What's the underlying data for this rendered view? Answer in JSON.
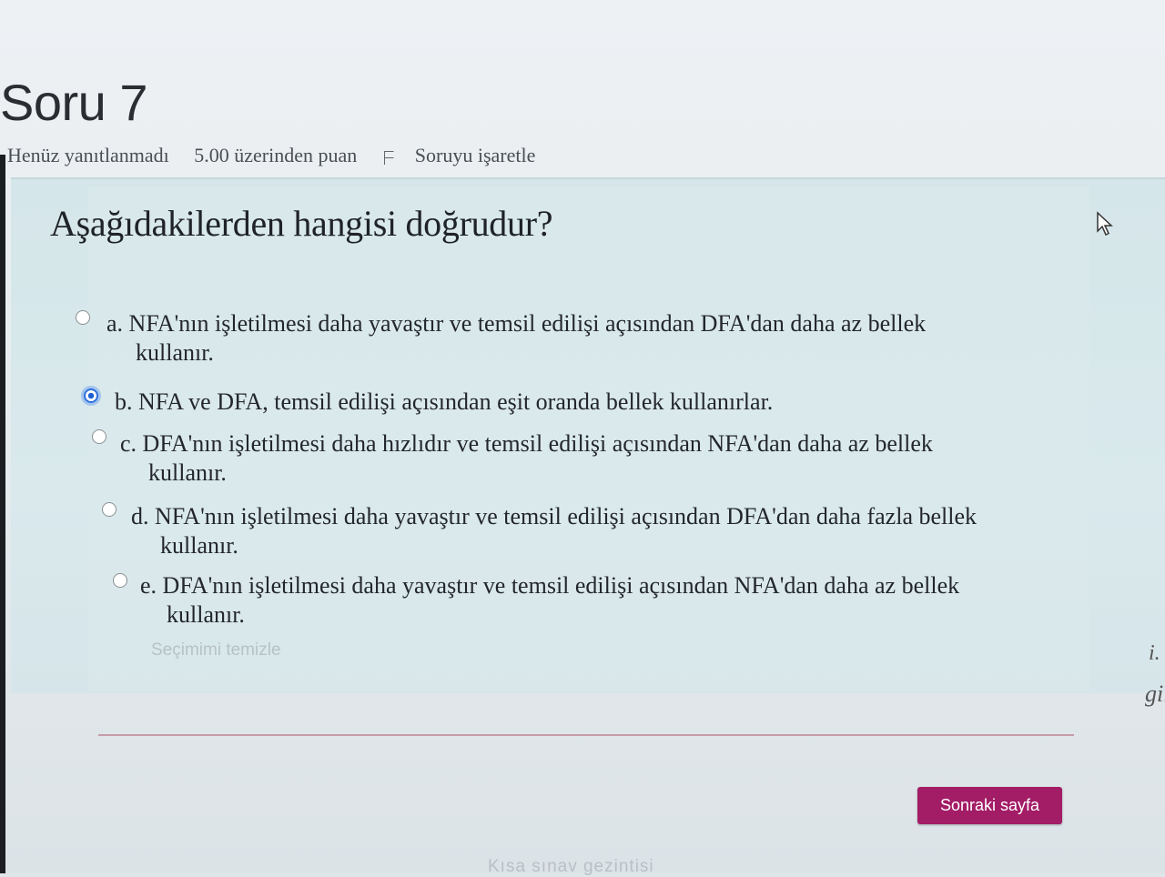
{
  "header": {
    "title": "Soru 7",
    "status": "Henüz yanıtlanmadı",
    "points": "5.00 üzerinden puan",
    "flag_label": "Soruyu işaretle"
  },
  "question": {
    "text": "Aşağıdakilerden hangisi doğrudur?",
    "options": [
      {
        "line1": "a. NFA'nın işletilmesi daha yavaştır ve temsil edilişi açısından DFA'dan daha az bellek",
        "line2": "kullanır.",
        "selected": false
      },
      {
        "line1": "b. NFA ve DFA, temsil edilişi açısından eşit oranda bellek kullanırlar.",
        "line2": "",
        "selected": true
      },
      {
        "line1": "c. DFA'nın işletilmesi daha hızlıdır ve temsil edilişi açısından NFA'dan daha az bellek",
        "line2": "kullanır.",
        "selected": false
      },
      {
        "line1": "d. NFA'nın işletilmesi daha yavaştır ve temsil edilişi açısından DFA'dan daha fazla bellek",
        "line2": "kullanır.",
        "selected": false
      },
      {
        "line1": "e. DFA'nın işletilmesi daha yavaştır ve temsil edilişi açısından NFA'dan daha az bellek",
        "line2": "kullanır.",
        "selected": false
      }
    ],
    "clear_label": "Seçimimi temizle"
  },
  "footer": {
    "next_label": "Sonraki sayfa",
    "nav_title": "Kısa sınav gezintisi"
  },
  "edge_text": {
    "first": "i.",
    "second": "gil"
  },
  "colors": {
    "accent": "#a31c66",
    "radio_selected": "#1d5fd1"
  }
}
